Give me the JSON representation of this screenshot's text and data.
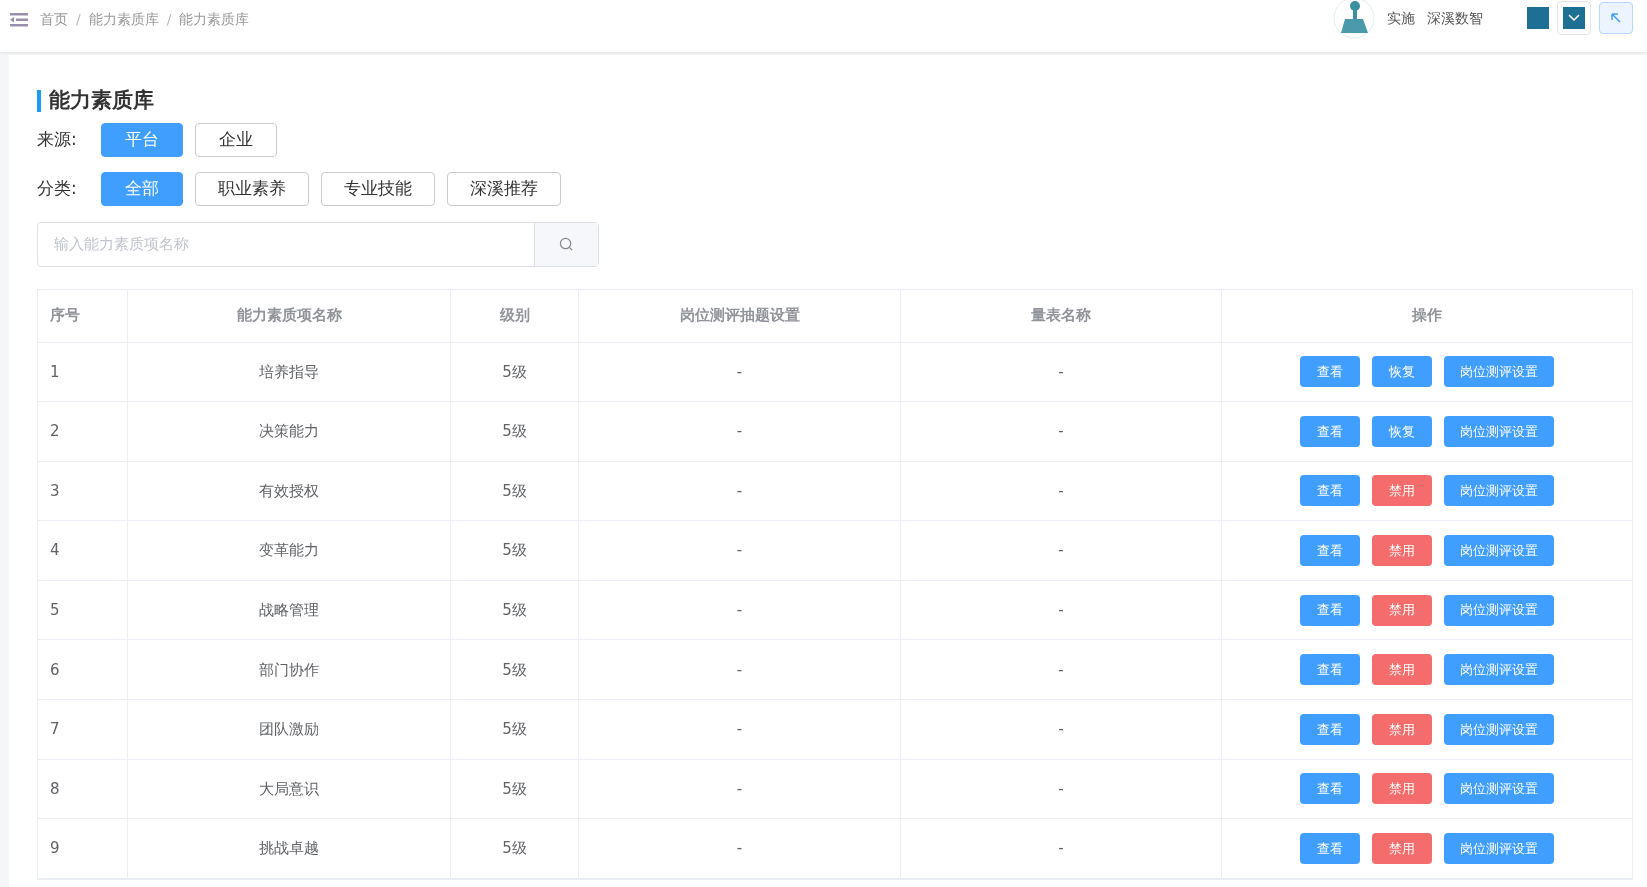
{
  "breadcrumb": [
    "首页",
    "能力素质库",
    "能力素质库"
  ],
  "breadcrumb_separator": "/",
  "user": {
    "role": "实施",
    "company": "深溪数智"
  },
  "title": "能力素质库",
  "filters": [
    {
      "label": "来源:",
      "options": [
        {
          "label": "平台",
          "selected": true
        },
        {
          "label": "企业",
          "selected": false
        }
      ]
    },
    {
      "label": "分类:",
      "options": [
        {
          "label": "全部",
          "selected": true
        },
        {
          "label": "职业素养",
          "selected": false
        },
        {
          "label": "专业技能",
          "selected": false
        },
        {
          "label": "深溪推荐",
          "selected": false
        }
      ]
    }
  ],
  "search": {
    "placeholder": "输入能力素质项名称"
  },
  "table": {
    "columns": [
      "序号",
      "能力素质项名称",
      "级别",
      "岗位测评抽题设置",
      "量表名称",
      "操作"
    ],
    "rows": [
      {
        "index": "1",
        "name": "培养指导",
        "level": "5级",
        "draw_setting": "-",
        "scale": "-",
        "actions": [
          {
            "kind": "primary",
            "label": "查看"
          },
          {
            "kind": "primary",
            "label": "恢复"
          },
          {
            "kind": "primary",
            "label": "岗位测评设置"
          }
        ]
      },
      {
        "index": "2",
        "name": "决策能力",
        "level": "5级",
        "draw_setting": "-",
        "scale": "-",
        "actions": [
          {
            "kind": "primary",
            "label": "查看"
          },
          {
            "kind": "primary",
            "label": "恢复"
          },
          {
            "kind": "primary",
            "label": "岗位测评设置"
          }
        ]
      },
      {
        "index": "3",
        "name": "有效授权",
        "level": "5级",
        "draw_setting": "-",
        "scale": "-",
        "actions": [
          {
            "kind": "primary",
            "label": "查看"
          },
          {
            "kind": "danger",
            "label": "禁用"
          },
          {
            "kind": "primary",
            "label": "岗位测评设置"
          }
        ]
      },
      {
        "index": "4",
        "name": "变革能力",
        "level": "5级",
        "draw_setting": "-",
        "scale": "-",
        "actions": [
          {
            "kind": "primary",
            "label": "查看"
          },
          {
            "kind": "danger",
            "label": "禁用"
          },
          {
            "kind": "primary",
            "label": "岗位测评设置"
          }
        ]
      },
      {
        "index": "5",
        "name": "战略管理",
        "level": "5级",
        "draw_setting": "-",
        "scale": "-",
        "actions": [
          {
            "kind": "primary",
            "label": "查看"
          },
          {
            "kind": "danger",
            "label": "禁用"
          },
          {
            "kind": "primary",
            "label": "岗位测评设置"
          }
        ]
      },
      {
        "index": "6",
        "name": "部门协作",
        "level": "5级",
        "draw_setting": "-",
        "scale": "-",
        "actions": [
          {
            "kind": "primary",
            "label": "查看"
          },
          {
            "kind": "danger",
            "label": "禁用"
          },
          {
            "kind": "primary",
            "label": "岗位测评设置"
          }
        ]
      },
      {
        "index": "7",
        "name": "团队激励",
        "level": "5级",
        "draw_setting": "-",
        "scale": "-",
        "actions": [
          {
            "kind": "primary",
            "label": "查看"
          },
          {
            "kind": "danger",
            "label": "禁用"
          },
          {
            "kind": "primary",
            "label": "岗位测评设置"
          }
        ]
      },
      {
        "index": "8",
        "name": "大局意识",
        "level": "5级",
        "draw_setting": "-",
        "scale": "-",
        "actions": [
          {
            "kind": "primary",
            "label": "查看"
          },
          {
            "kind": "danger",
            "label": "禁用"
          },
          {
            "kind": "primary",
            "label": "岗位测评设置"
          }
        ]
      },
      {
        "index": "9",
        "name": "挑战卓越",
        "level": "5级",
        "draw_setting": "-",
        "scale": "-",
        "actions": [
          {
            "kind": "primary",
            "label": "查看"
          },
          {
            "kind": "danger",
            "label": "禁用"
          },
          {
            "kind": "primary",
            "label": "岗位测评设置"
          }
        ]
      }
    ]
  }
}
